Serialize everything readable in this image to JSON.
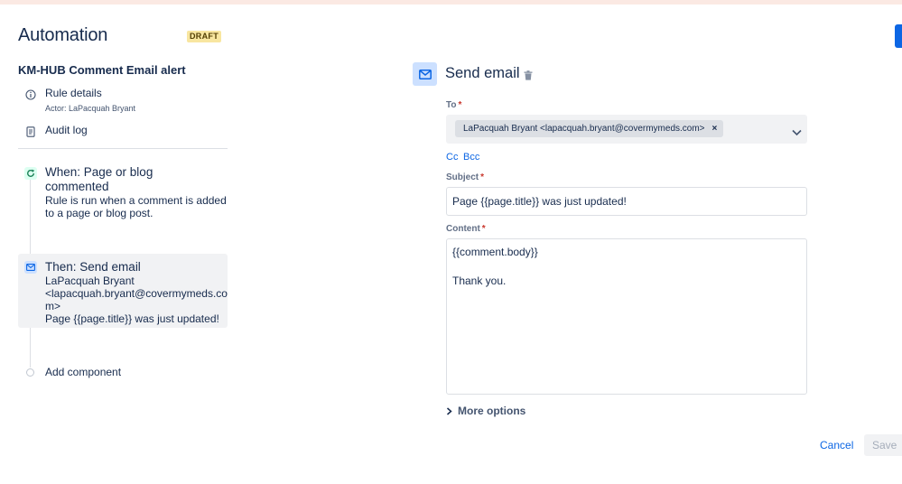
{
  "app": {
    "title": "Automation",
    "status_badge": "DRAFT"
  },
  "rule": {
    "name": "KM-HUB Comment Email alert"
  },
  "sidebar": {
    "rule_details": {
      "label": "Rule details",
      "actor": "Actor: LaPacquah Bryant",
      "icon": "info-icon"
    },
    "audit_log": {
      "label": "Audit log",
      "icon": "document-icon"
    }
  },
  "steps": {
    "trigger": {
      "title_line1": "When: Page or blog",
      "title_line2": "commented",
      "desc_line1": "Rule is run when a comment is added",
      "desc_line2": "to a page or blog post.",
      "icon": "refresh-icon"
    },
    "action": {
      "title": "Then: Send email",
      "line1": "LaPacquah Bryant",
      "line2": "<lapacquah.bryant@covermymeds.co",
      "line3": "m>",
      "line4": "Page {{page.title}} was just updated!",
      "icon": "mail-icon"
    },
    "add_component": "Add component"
  },
  "panel": {
    "title": "Send email",
    "icon": "mail-icon",
    "to_label": "To",
    "to_recipient": "LaPacquah Bryant <lapacquah.bryant@covermymeds.com>",
    "cc_label": "Cc",
    "bcc_label": "Bcc",
    "subject_label": "Subject",
    "subject_value": "Page {{page.title}} was just updated!",
    "content_label": "Content",
    "content_line1": "{{comment.body}}",
    "content_line2": "",
    "content_line3": "Thank you.",
    "more_options": "More options",
    "required_mark": "*"
  },
  "footer": {
    "cancel_label": "Cancel",
    "save_label": "Save"
  },
  "colors": {
    "accent": "#0c66e4",
    "draft_badge_bg": "#f8e6a0",
    "trigger_icon": "#1f845a",
    "required": "#c9372c"
  }
}
